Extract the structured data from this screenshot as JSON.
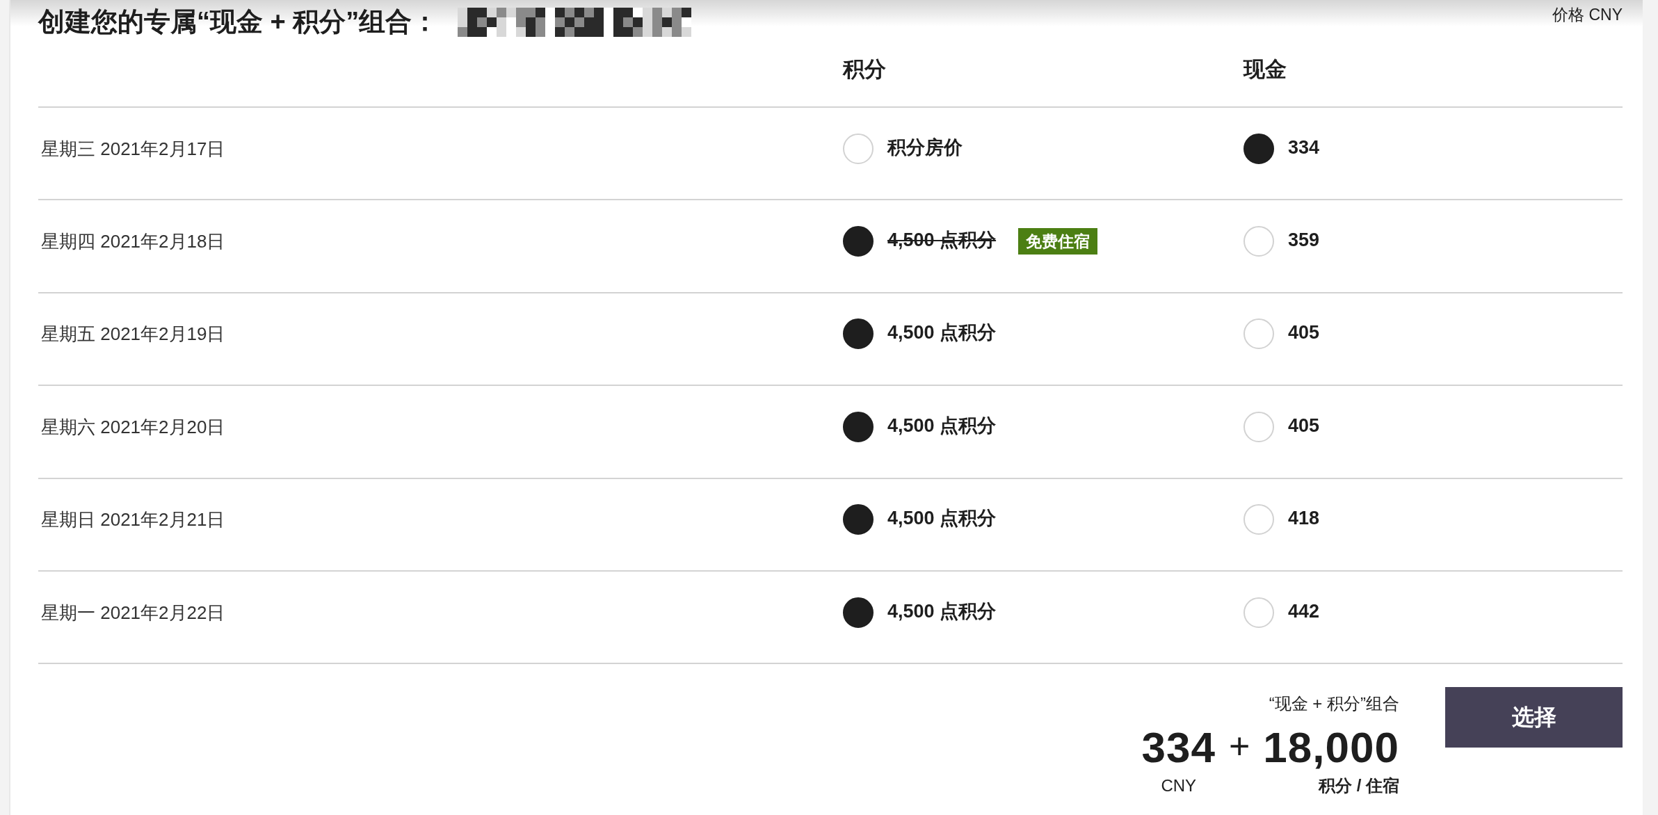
{
  "title": "创建您的专属“现金 + 积分”组合：",
  "currency_note": "价格 CNY",
  "table": {
    "columns": [
      "积分",
      "现金"
    ],
    "rows": [
      {
        "date": "星期三 2021年2月17日",
        "points": {
          "label": "积分房价",
          "selected": false,
          "struck": false
        },
        "cash": {
          "label": "334",
          "selected": true
        }
      },
      {
        "date": "星期四 2021年2月18日",
        "points": {
          "label": "4,500 点积分",
          "selected": true,
          "struck": true,
          "badge": "免费住宿"
        },
        "cash": {
          "label": "359",
          "selected": false
        }
      },
      {
        "date": "星期五 2021年2月19日",
        "points": {
          "label": "4,500 点积分",
          "selected": true,
          "struck": false
        },
        "cash": {
          "label": "405",
          "selected": false
        }
      },
      {
        "date": "星期六 2021年2月20日",
        "points": {
          "label": "4,500 点积分",
          "selected": true,
          "struck": false
        },
        "cash": {
          "label": "405",
          "selected": false
        }
      },
      {
        "date": "星期日 2021年2月21日",
        "points": {
          "label": "4,500 点积分",
          "selected": true,
          "struck": false
        },
        "cash": {
          "label": "418",
          "selected": false
        }
      },
      {
        "date": "星期一 2021年2月22日",
        "points": {
          "label": "4,500 点积分",
          "selected": true,
          "struck": false
        },
        "cash": {
          "label": "442",
          "selected": false
        }
      }
    ]
  },
  "summary": {
    "caption": "“现金 + 积分”组合",
    "cash_amount": "334",
    "operator": "+",
    "points_amount": "18,000",
    "cash_unit": "CNY",
    "points_unit": "积分 / 住宿"
  },
  "select_button": "选择"
}
